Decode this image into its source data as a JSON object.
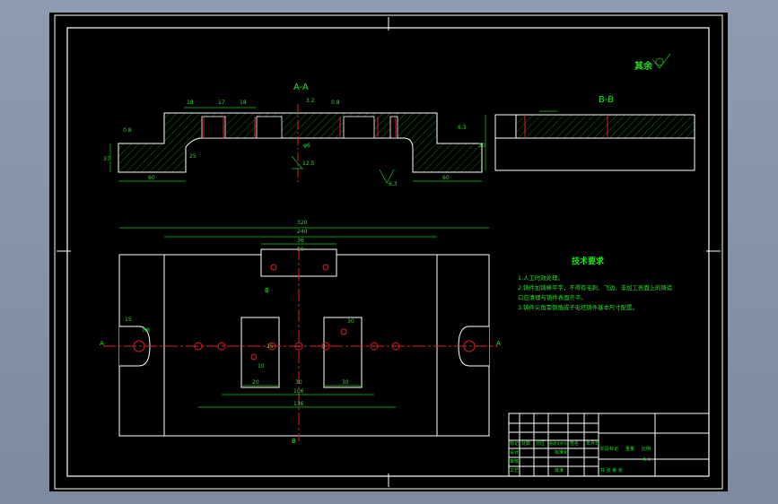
{
  "section_labels": {
    "aa": "A-A",
    "bb": "B-B",
    "a_left": "A",
    "a_right": "A",
    "b_top": "B",
    "b_bottom": "B"
  },
  "surface_note": "其余",
  "tech_requirements": {
    "title": "技术要求",
    "items": [
      "1.人工时效处理。",
      "2.铸件加铸棒平字，不得有毛刺、飞边、非加工表面上的铸造",
      "口应清理与铸件表面齐平。",
      "3.铸件尖角需倒角成子毛坯铸件基本尺寸配置。"
    ]
  },
  "dimensions": {
    "top_left": [
      "0.8",
      "37",
      "60",
      "25",
      "18",
      "17",
      "18"
    ],
    "top_mid": [
      "3.2",
      "0.8",
      "φ6",
      "12.5"
    ],
    "top_right": [
      "6.3",
      "6.3",
      "60"
    ],
    "bb_side": "30",
    "plan": [
      "320",
      "240",
      "36",
      "50",
      "15",
      "R8",
      "10",
      "30",
      "30",
      "20",
      "30",
      "106",
      "136",
      "25"
    ]
  },
  "title_block": {
    "row_labels": [
      "标记",
      "处数",
      "分区",
      "更改文件号",
      "签名",
      "年月日"
    ],
    "design": "设计",
    "standard": "标准化",
    "review": "审核",
    "process": "工艺",
    "approve": "批准",
    "stage": "阶段标记",
    "weight": "重量",
    "scale": "比例",
    "scale_value": "1:1",
    "sheets": "共 张 第 张"
  }
}
